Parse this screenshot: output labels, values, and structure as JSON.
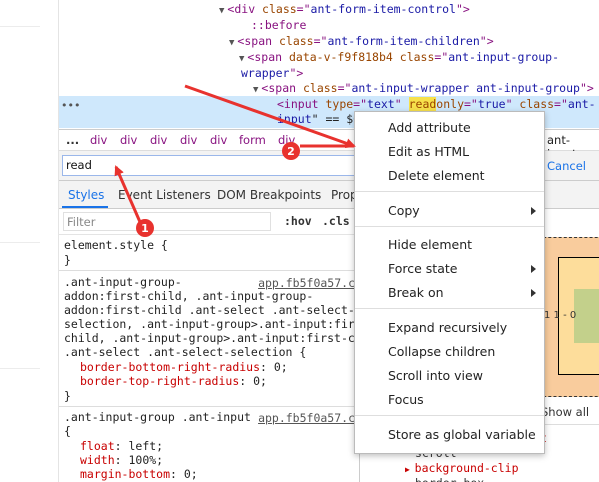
{
  "dom_tree": {
    "line1": {
      "open": "<div ",
      "attr": "class",
      "eq": "=\"",
      "val": "ant-form-item-control",
      "close": "\">"
    },
    "line2": "::before",
    "line3": {
      "open": "<span ",
      "attr": "class",
      "eq": "=\"",
      "val": "ant-form-item-children",
      "close": "\">"
    },
    "line4": {
      "open": "<span ",
      "attr1": "data-v-f9f818b4",
      "attr2": "class",
      "eq": "=\"",
      "val": "ant-input-group-",
      "close": "\""
    },
    "line4b": {
      "val": "wrapper",
      "close": "\">"
    },
    "line5": {
      "open": "<span ",
      "attr": "class",
      "eq": "=\"",
      "val": "ant-input-wrapper ant-input-group",
      "close": "\">"
    },
    "line6": {
      "open": "<input ",
      "attr1": "type",
      "val1": "text",
      "attr2_hl": "read",
      "attr2_rest": "only",
      "val2": "true",
      "attr3": "class",
      "val3": "ant-"
    },
    "line6b": {
      "val": "input",
      "rest": "\" == $0"
    },
    "dots": "•••"
  },
  "breadcrumbs": {
    "dots": "...",
    "items": [
      "div",
      "div",
      "div",
      "div",
      "div",
      "form",
      "div"
    ],
    "last": "ant-input"
  },
  "search": {
    "value": "read",
    "cancel": "Cancel"
  },
  "tabs": [
    "Styles",
    "Event Listeners",
    "DOM Breakpoints",
    "Prop"
  ],
  "filter": {
    "placeholder": "Filter",
    "hov": ":hov",
    "cls": ".cls"
  },
  "styles": {
    "rule1_selector": "element.style {",
    "rule1_close": "}",
    "rule2_src": "app.fb5f0a57.c",
    "rule2_selector": [
      ".ant-input-group-",
      "addon:first-child, .ant-input-group-",
      "addon:first-child .ant-select .ant-select-",
      "selection, .ant-input-group>.ant-input:first",
      "child, .ant-input-group>.ant-input:first-chi",
      ".ant-select .ant-select-selection {"
    ],
    "rule2_props": [
      {
        "name": "border-bottom-right-radius",
        "value": " 0;"
      },
      {
        "name": "border-top-right-radius",
        "value": " 0;"
      }
    ],
    "rule2_close": "}",
    "rule3_src": "app.fb5f0a57.c",
    "rule3_selector": ".ant-input-group .ant-input",
    "rule3_open": "{",
    "rule3_props": [
      {
        "name": "float",
        "value": " left;"
      },
      {
        "name": "width",
        "value": " 100%;"
      },
      {
        "name": "margin-bottom",
        "value": " 0;"
      }
    ]
  },
  "computed": {
    "box_nums": "1  1  -  0",
    "show_all": "Show all",
    "lines": [
      "t",
      "scroll",
      "background-clip",
      "border-box"
    ]
  },
  "context_menu": {
    "items": [
      "Add attribute",
      "Edit as HTML",
      "Delete element",
      "Copy",
      "Hide element",
      "Force state",
      "Break on",
      "Expand recursively",
      "Collapse children",
      "Scroll into view",
      "Focus",
      "Store as global variable"
    ]
  },
  "annotations": {
    "badge1": "1",
    "badge2": "2"
  },
  "colors": {
    "annotation_red": "#e8322e",
    "selection": "#cfe8fc",
    "highlight": "#f7e14b",
    "accent": "#1a73e8"
  }
}
